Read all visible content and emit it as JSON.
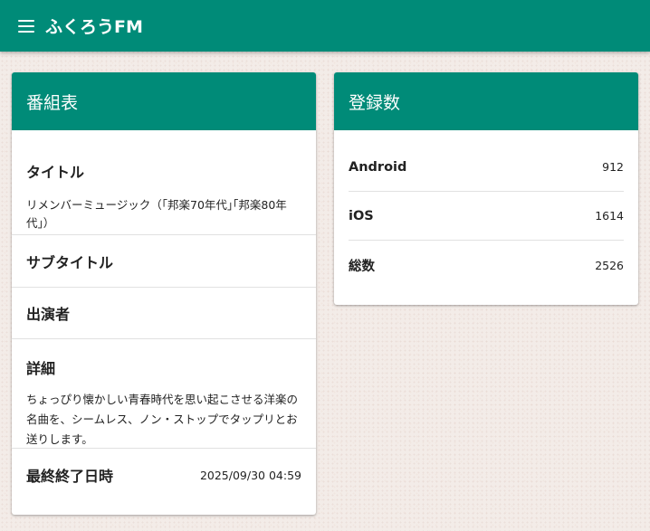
{
  "app": {
    "title": "ふくろうFM"
  },
  "schedule": {
    "header": "番組表",
    "title_label": "タイトル",
    "title_value": "リメンバーミュージック（｢邦楽70年代｣｢邦楽80年代｣）",
    "subtitle_label": "サブタイトル",
    "cast_label": "出演者",
    "detail_label": "詳細",
    "detail_value": "ちょっぴり懐かしい青春時代を思い起こさせる洋楽の名曲を、シームレス、ノン・ストップでタップリとお送りします。",
    "updated_label": "最終終了日時",
    "updated_value": "2025/09/30 04:59"
  },
  "registrations": {
    "header": "登録数",
    "rows": [
      {
        "label": "Android",
        "value": "912"
      },
      {
        "label": "iOS",
        "value": "1614"
      },
      {
        "label": "総数",
        "value": "2526"
      }
    ]
  },
  "colors": {
    "primary": "#008b78",
    "background": "#f3ece8"
  },
  "icons": {
    "menu": "menu-icon"
  }
}
